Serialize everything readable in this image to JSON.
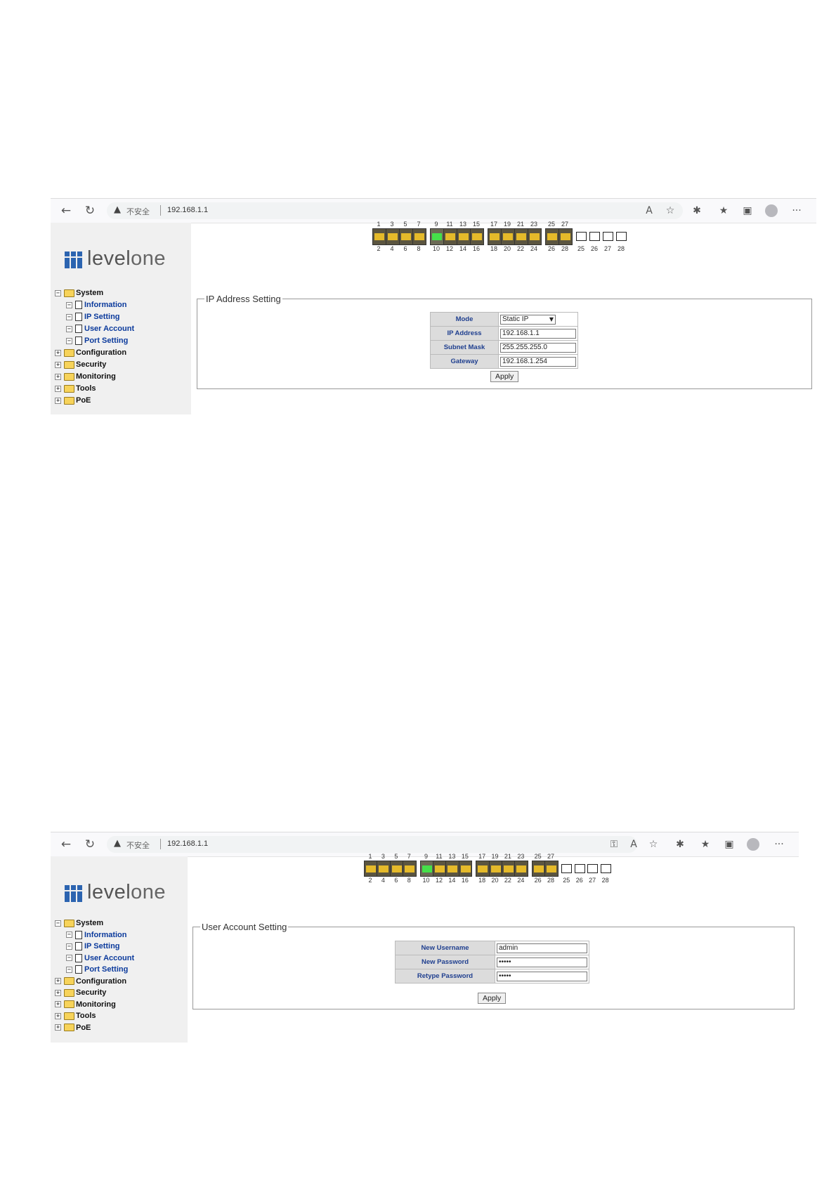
{
  "browser": {
    "insecure_label": "不安全",
    "url": "192.168.1.1",
    "icons": [
      "back-icon",
      "refresh-icon",
      "warning-icon",
      "read-aloud-icon",
      "add-favorite-icon",
      "extensions-icon",
      "favorites-icon",
      "collections-icon",
      "profile-icon",
      "more-icon"
    ]
  },
  "logo": {
    "part1": "level",
    "part2": "one"
  },
  "tree": {
    "system": "System",
    "information": "Information",
    "ip_setting": "IP Setting",
    "user_account": "User Account",
    "port_setting": "Port Setting",
    "configuration": "Configuration",
    "security": "Security",
    "monitoring": "Monitoring",
    "tools": "Tools",
    "poe": "PoE"
  },
  "ports": {
    "top_labels": [
      "1",
      "3",
      "5",
      "7",
      "9",
      "11",
      "13",
      "15",
      "17",
      "19",
      "21",
      "23",
      "25",
      "27"
    ],
    "bottom_labels": [
      "2",
      "4",
      "6",
      "8",
      "10",
      "12",
      "14",
      "16",
      "18",
      "20",
      "22",
      "24",
      "26",
      "28"
    ],
    "sfp_labels": [
      "25",
      "26",
      "27",
      "28"
    ],
    "active_ports": [
      "9"
    ]
  },
  "ip_setting": {
    "legend": "IP Address Setting",
    "mode_label": "Mode",
    "mode_value": "Static IP",
    "ip_label": "IP Address",
    "ip_value": "192.168.1.1",
    "mask_label": "Subnet Mask",
    "mask_value": "255.255.255.0",
    "gateway_label": "Gateway",
    "gateway_value": "192.168.1.254",
    "apply": "Apply"
  },
  "user_account": {
    "legend": "User Account Setting",
    "username_label": "New Username",
    "username_value": "admin",
    "password_label": "New Password",
    "password_value": "•••••",
    "retype_label": "Retype Password",
    "retype_value": "•••••",
    "apply": "Apply"
  }
}
